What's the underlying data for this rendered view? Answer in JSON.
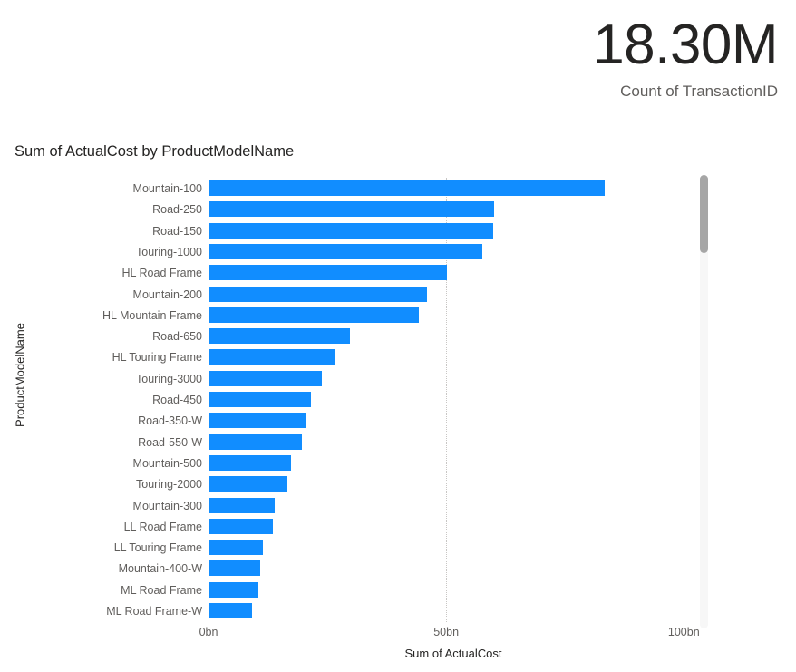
{
  "kpi": {
    "value": "18.30M",
    "label": "Count of TransactionID"
  },
  "chart": {
    "title": "Sum of ActualCost by ProductModelName",
    "x_axis_title": "Sum of ActualCost",
    "y_axis_title": "ProductModelName",
    "bar_color": "#118DFF",
    "scrollbar": {
      "thumb_color": "#a6a6a6",
      "track_color": "#f7f7f7"
    }
  },
  "chart_data": {
    "type": "bar",
    "orientation": "horizontal",
    "title": "Sum of ActualCost by ProductModelName",
    "xlabel": "Sum of ActualCost",
    "ylabel": "ProductModelName",
    "xlim": [
      0,
      103
    ],
    "xticks": [
      0,
      50,
      100
    ],
    "xticklabels": [
      "0bn",
      "50bn",
      "100bn"
    ],
    "grid": true,
    "legend": false,
    "units": "bn",
    "categories": [
      "Mountain-100",
      "Road-250",
      "Road-150",
      "Touring-1000",
      "HL Road Frame",
      "Mountain-200",
      "HL Mountain Frame",
      "Road-650",
      "HL Touring Frame",
      "Touring-3000",
      "Road-450",
      "Road-350-W",
      "Road-550-W",
      "Mountain-500",
      "Touring-2000",
      "Mountain-300",
      "LL Road Frame",
      "LL Touring Frame",
      "Mountain-400-W",
      "ML Road Frame",
      "ML Road Frame-W"
    ],
    "values": [
      83.4,
      60.1,
      59.9,
      57.6,
      50.1,
      46.0,
      44.3,
      29.8,
      26.7,
      23.8,
      21.6,
      20.6,
      19.6,
      17.4,
      16.6,
      13.9,
      13.5,
      11.4,
      10.9,
      10.5,
      9.2
    ]
  }
}
